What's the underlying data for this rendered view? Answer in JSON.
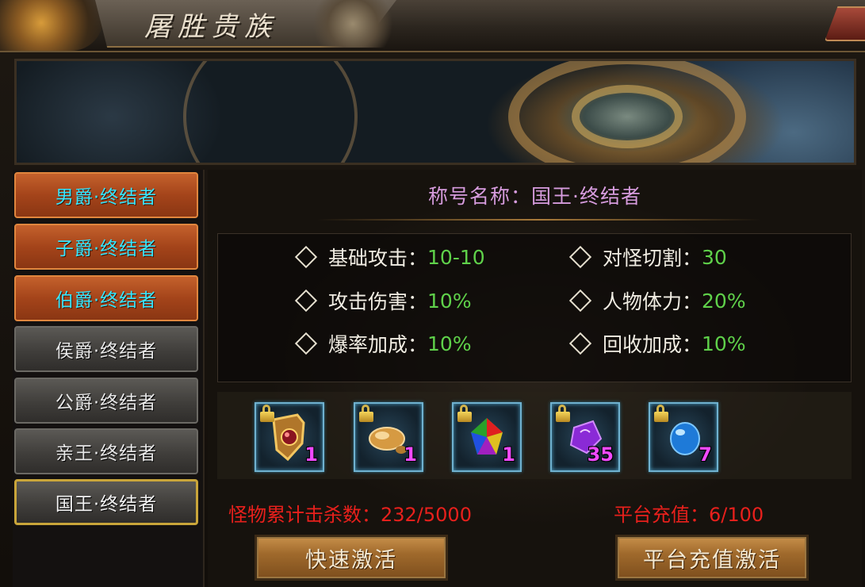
{
  "window": {
    "title": "屠胜贵族"
  },
  "sidebar": {
    "tabs": [
      {
        "label": "男爵·终结者",
        "state": "activated"
      },
      {
        "label": "子爵·终结者",
        "state": "activated"
      },
      {
        "label": "伯爵·终结者",
        "state": "activated"
      },
      {
        "label": "侯爵·终结者",
        "state": "locked"
      },
      {
        "label": "公爵·终结者",
        "state": "locked"
      },
      {
        "label": "亲王·终结者",
        "state": "locked"
      },
      {
        "label": "国王·终结者",
        "state": "selected"
      }
    ]
  },
  "title_info": {
    "label": "称号名称：",
    "name": "国王·终结者"
  },
  "stats": [
    {
      "label": "基础攻击：",
      "value": "10-10"
    },
    {
      "label": "对怪切割：",
      "value": "30"
    },
    {
      "label": "攻击伤害：",
      "value": "10%"
    },
    {
      "label": "人物体力：",
      "value": "20%"
    },
    {
      "label": "爆率加成：",
      "value": "10%"
    },
    {
      "label": "回收加成：",
      "value": "10%"
    }
  ],
  "items": [
    {
      "icon": "gold-armor-icon",
      "count": "1"
    },
    {
      "icon": "gold-nugget-icon",
      "count": "1"
    },
    {
      "icon": "rainbow-gem-icon",
      "count": "1"
    },
    {
      "icon": "purple-crystal-icon",
      "count": "35"
    },
    {
      "icon": "blue-orb-icon",
      "count": "7"
    }
  ],
  "progress": {
    "kills_label": "怪物累计击杀数：",
    "kills_value": "232/5000",
    "recharge_label": "平台充值：",
    "recharge_value": "6/100"
  },
  "buttons": {
    "quick_activate": "快速激活",
    "recharge_activate": "平台充值激活"
  },
  "colors": {
    "accent_cyan": "#37e6ff",
    "stat_green": "#5fd14a",
    "name_purple": "#d69bdd",
    "progress_red": "#e8201c",
    "count_magenta": "#f04aff"
  }
}
